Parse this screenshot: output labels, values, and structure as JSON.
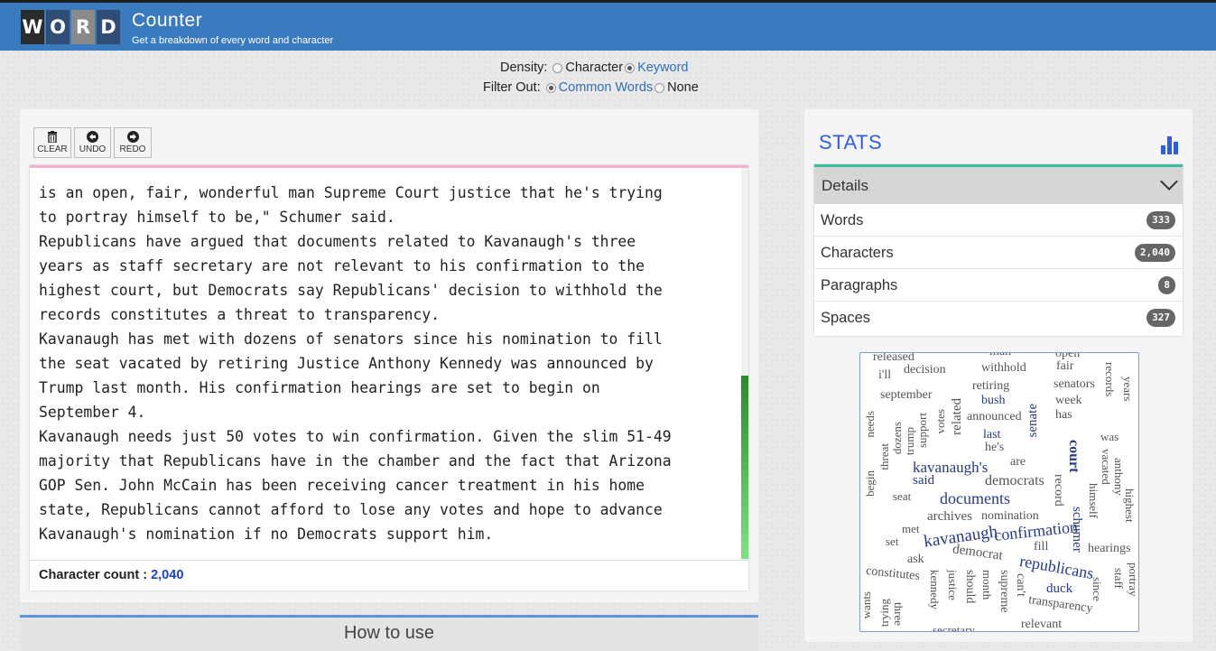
{
  "brand": {
    "letters": [
      "W",
      "O",
      "R",
      "D"
    ],
    "title": "Counter",
    "subtitle": "Get a breakdown of every word and character"
  },
  "density": {
    "label": "Density:",
    "options": [
      {
        "label": "Character",
        "selected": false
      },
      {
        "label": "Keyword",
        "selected": true
      }
    ]
  },
  "filter": {
    "label": "Filter Out:",
    "options": [
      {
        "label": "Common Words",
        "selected": true
      },
      {
        "label": "None",
        "selected": false
      }
    ]
  },
  "toolbar": {
    "clear": "CLEAR",
    "undo": "UNDO",
    "redo": "REDO"
  },
  "editor": {
    "text": "is an open, fair, wonderful man Supreme Court justice that he's trying\nto portray himself to be,\" Schumer said.\nRepublicans have argued that documents related to Kavanaugh's three\nyears as staff secretary are not relevant to his confirmation to the\nhighest court, but Democrats say Republicans' decision to withhold the\nrecords constitutes a threat to transparency.\nKavanaugh has met with dozens of senators since his nomination to fill\nthe seat vacated by retiring Justice Anthony Kennedy was announced by\nTrump last month. His confirmation hearings are set to begin on\nSeptember 4.\nKavanaugh needs just 50 votes to win confirmation. Given the slim 51-49\nmajority that Republicans have in the chamber and the fact that Arizona\nGOP Sen. John McCain has been receiving cancer treatment in his home\nstate, Republicans cannot afford to lose any votes and hope to advance\nKavanaugh's nomination if no Democrats support him.",
    "char_count_label": "Character count : ",
    "char_count": "2,040"
  },
  "howto": {
    "label": "How to use"
  },
  "stats": {
    "title": "STATS",
    "details_label": "Details",
    "rows": [
      {
        "label": "Words",
        "value": "333"
      },
      {
        "label": "Characters",
        "value": "2,040"
      },
      {
        "label": "Paragraphs",
        "value": "8"
      },
      {
        "label": "Spaces",
        "value": "327"
      }
    ]
  },
  "word_cloud": [
    "released",
    "man",
    "open",
    "decision",
    "withhold",
    "fair",
    "records",
    "years",
    "i'll",
    "retiring",
    "senators",
    "september",
    "bush",
    "week",
    "related",
    "announced",
    "senate",
    "has",
    "needs",
    "support",
    "votes",
    "last",
    "he's",
    "was",
    "dozens",
    "trump",
    "court",
    "vacated",
    "anthony",
    "threat",
    "kavanaugh's",
    "are",
    "democrats",
    "said",
    "himself",
    "highest",
    "begin",
    "seat",
    "documents",
    "record",
    "archives",
    "nomination",
    "met",
    "schumer",
    "set",
    "kavanaugh",
    "confirmation",
    "fill",
    "hearings",
    "ask",
    "democrat",
    "republicans",
    "constitutes",
    "kennedy",
    "justice",
    "should",
    "month",
    "supreme",
    "can't",
    "duck",
    "since",
    "staff",
    "portray",
    "wants",
    "trying",
    "three",
    "transparency",
    "relevant",
    "secretary"
  ]
}
